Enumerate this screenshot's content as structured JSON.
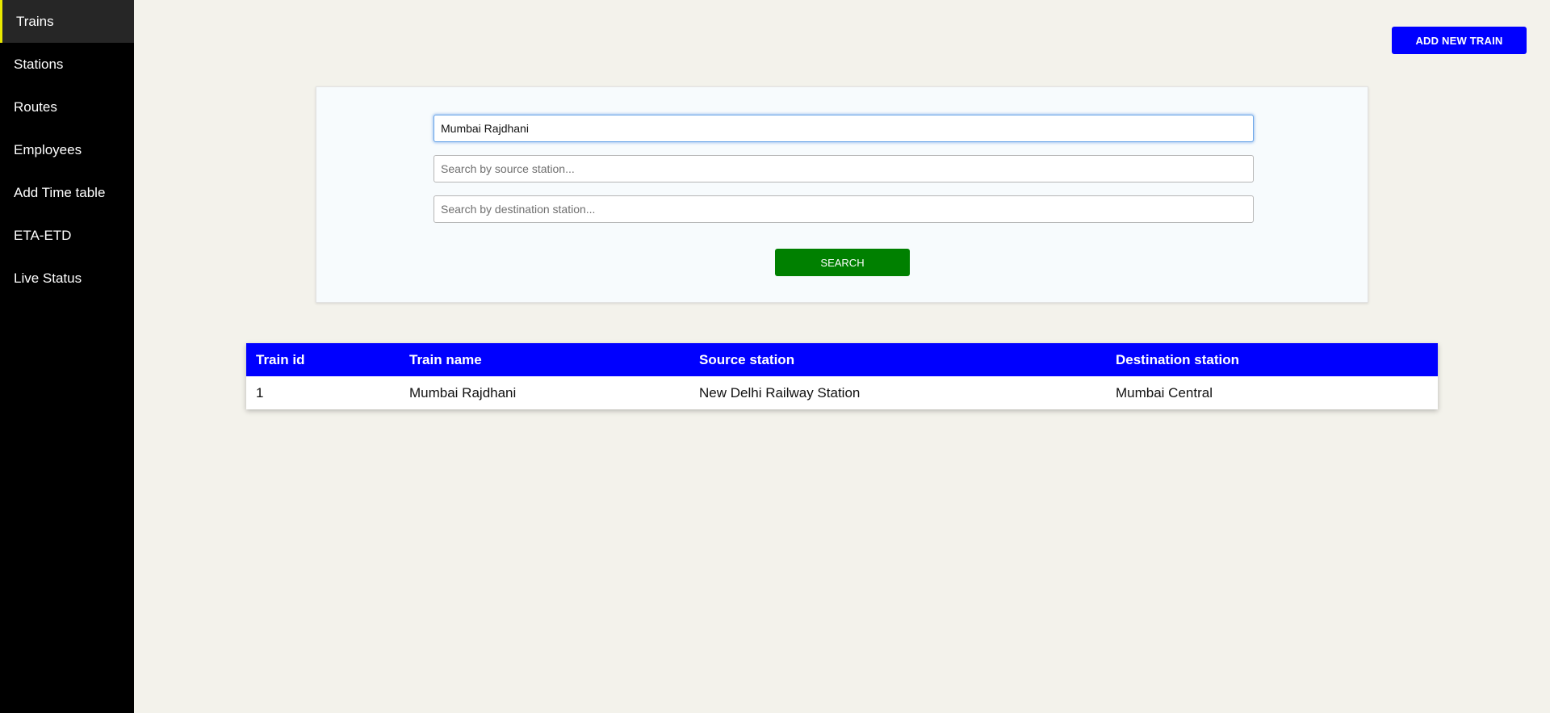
{
  "sidebar": {
    "items": [
      {
        "label": "Trains",
        "active": true
      },
      {
        "label": "Stations"
      },
      {
        "label": "Routes"
      },
      {
        "label": "Employees"
      },
      {
        "label": "Add Time table"
      },
      {
        "label": "ETA-ETD"
      },
      {
        "label": "Live Status"
      }
    ]
  },
  "header": {
    "add_button_label": "ADD NEW TRAIN"
  },
  "search": {
    "train_name_value": "Mumbai Rajdhani",
    "source_placeholder": "Search by source station...",
    "destination_placeholder": "Search by destination station...",
    "button_label": "SEARCH"
  },
  "table": {
    "columns": [
      "Train id",
      "Train name",
      "Source station",
      "Destination station"
    ],
    "rows": [
      [
        "1",
        "Mumbai Rajdhani",
        "New Delhi Railway Station",
        "Mumbai Central"
      ]
    ]
  },
  "colors": {
    "sidebar_bg": "#000000",
    "active_indicator": "#e8e800",
    "primary_blue": "#0000ff",
    "search_green": "#008000",
    "page_bg": "#f3f2eb"
  }
}
